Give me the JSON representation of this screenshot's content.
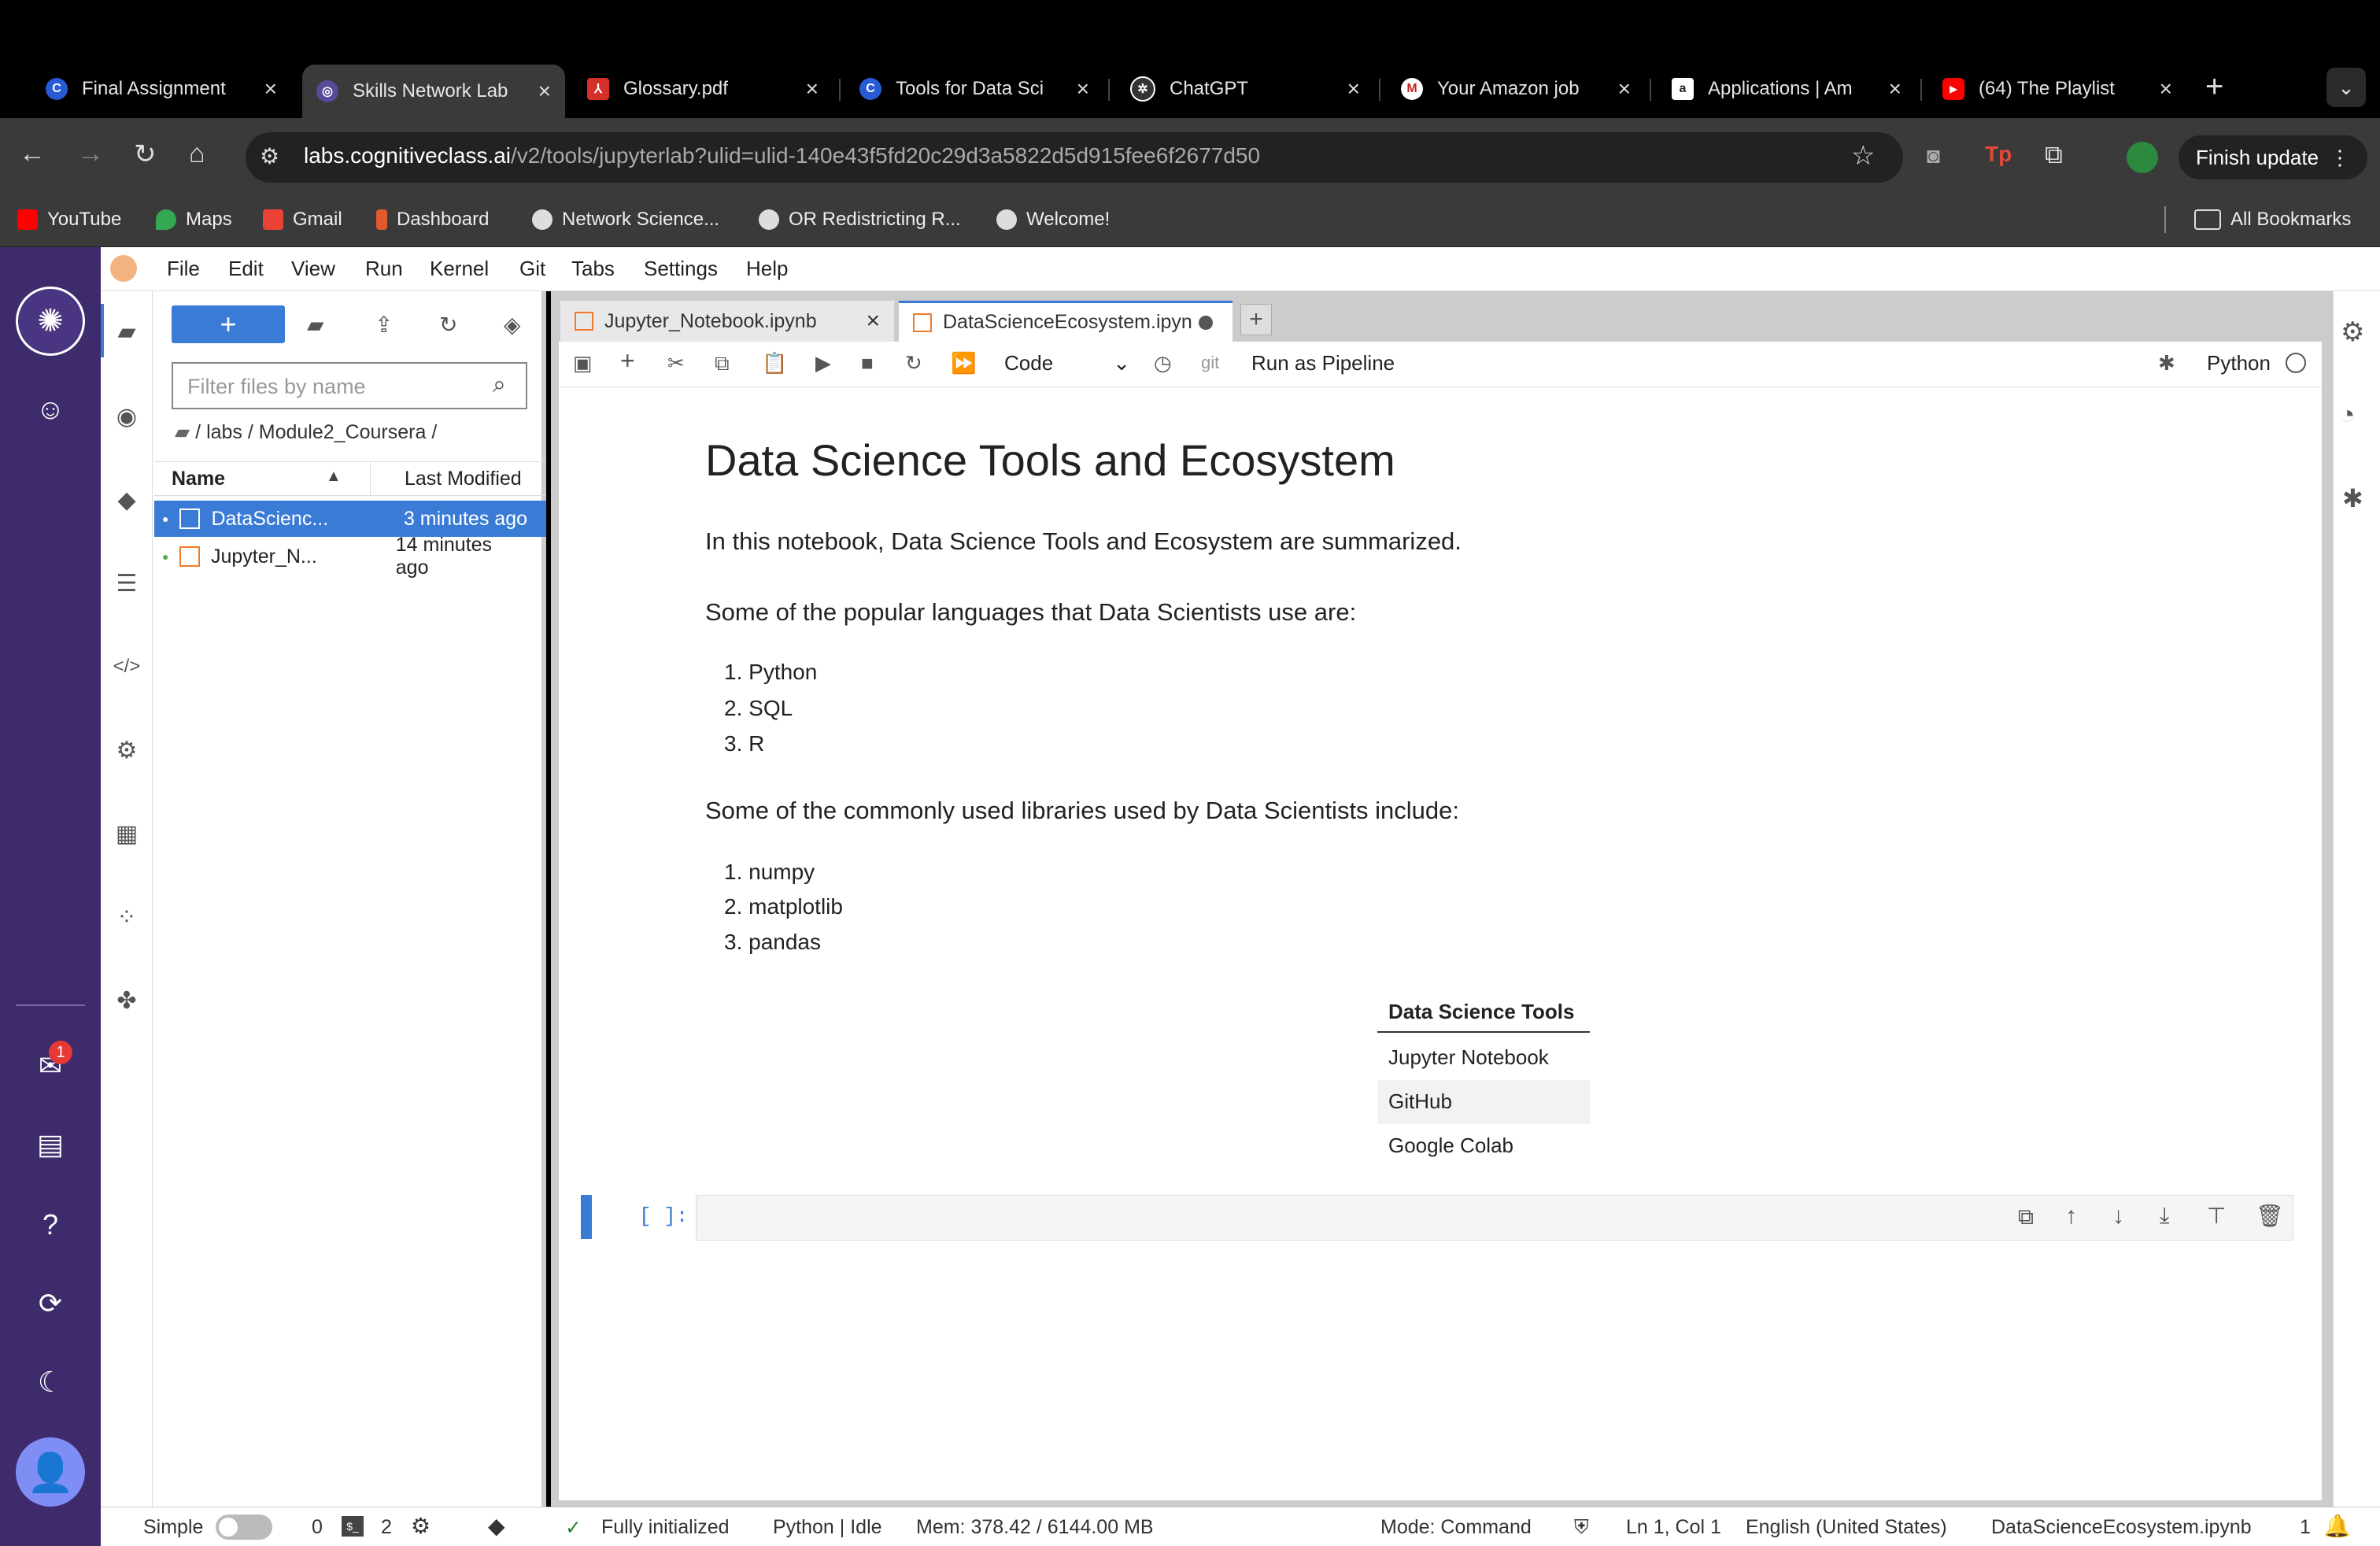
{
  "browser": {
    "tabs": [
      {
        "title": "Final Assignment",
        "favicon": "coursera-icon",
        "color": "#2a5bd7",
        "glyph": "C"
      },
      {
        "title": "Skills Network Lab",
        "favicon": "skills-network-icon",
        "color": "#5a4a9a",
        "glyph": "◎"
      },
      {
        "title": "Glossary.pdf",
        "favicon": "pdf-icon",
        "color": "#d4302a",
        "glyph": "⅄"
      },
      {
        "title": "Tools for Data Sci",
        "favicon": "coursera-icon",
        "color": "#2a5bd7",
        "glyph": "C"
      },
      {
        "title": "ChatGPT",
        "favicon": "chatgpt-icon",
        "color": "#333",
        "glyph": "✲"
      },
      {
        "title": "Your Amazon job",
        "favicon": "gmail-icon",
        "color": "#c5221f",
        "glyph": "M"
      },
      {
        "title": "Applications | Am",
        "favicon": "amazon-icon",
        "color": "#222",
        "glyph": "a"
      },
      {
        "title": "(64) The Playlist",
        "favicon": "youtube-icon",
        "color": "#ff0000",
        "glyph": "▶"
      }
    ],
    "new_tab": "+",
    "url_host": "labs.cognitiveclass.ai",
    "url_path": "/v2/tools/jupyterlab?ulid=ulid-140e43f5fd20c29d3a5822d5d915fee6f2677d50",
    "finish_update": "Finish update",
    "bookmarks": [
      {
        "label": "YouTube",
        "color": "#ff0000"
      },
      {
        "label": "Maps",
        "color": "#34a853"
      },
      {
        "label": "Gmail",
        "color": "#ea4335"
      },
      {
        "label": "Dashboard",
        "color": "#e05a2b"
      },
      {
        "label": "Network Science...",
        "color": "#ddd"
      },
      {
        "label": "OR Redistricting R...",
        "color": "#ddd"
      },
      {
        "label": "Welcome!",
        "color": "#ddd"
      }
    ],
    "all_bookmarks": "All Bookmarks"
  },
  "activity": {
    "notification_count": "1"
  },
  "menu": [
    "File",
    "Edit",
    "View",
    "Run",
    "Kernel",
    "Git",
    "Tabs",
    "Settings",
    "Help"
  ],
  "filebrowser": {
    "filter_placeholder": "Filter files by name",
    "breadcrumb": "/ labs / Module2_Coursera /",
    "col_name": "Name",
    "col_modified": "Last Modified",
    "files": [
      {
        "name": "DataScienc...",
        "modified": "3 minutes ago"
      },
      {
        "name": "Jupyter_N...",
        "modified": "14 minutes ago"
      }
    ]
  },
  "notebook_tabs": [
    {
      "label": "Jupyter_Notebook.ipynb"
    },
    {
      "label": "DataScienceEcosystem.ipyn"
    }
  ],
  "toolbar": {
    "cell_type": "Code",
    "git": "git",
    "run_pipeline": "Run as Pipeline",
    "kernel": "Python"
  },
  "content": {
    "title": "Data Science Tools and Ecosystem",
    "intro": "In this notebook, Data Science Tools and Ecosystem are summarized.",
    "languages_heading": "Some of the popular languages that Data Scientists use are:",
    "languages": [
      "Python",
      "SQL",
      "R"
    ],
    "libraries_heading": "Some of the commonly used libraries used by Data Scientists include:",
    "libraries": [
      "numpy",
      "matplotlib",
      "pandas"
    ],
    "table_header": "Data Science Tools",
    "table_rows": [
      "Jupyter Notebook",
      "GitHub",
      "Google Colab"
    ],
    "prompt": "[ ]:"
  },
  "status": {
    "mode_label": "Simple",
    "terminals": "0",
    "kernels": "2",
    "init": "Fully initialized",
    "kernel_state": "Python | Idle",
    "mem": "Mem: 378.42 / 6144.00 MB",
    "mode": "Mode: Command",
    "cursor": "Ln 1, Col 1",
    "language": "English (United States)",
    "filename": "DataScienceEcosystem.ipynb",
    "notifications": "1"
  }
}
